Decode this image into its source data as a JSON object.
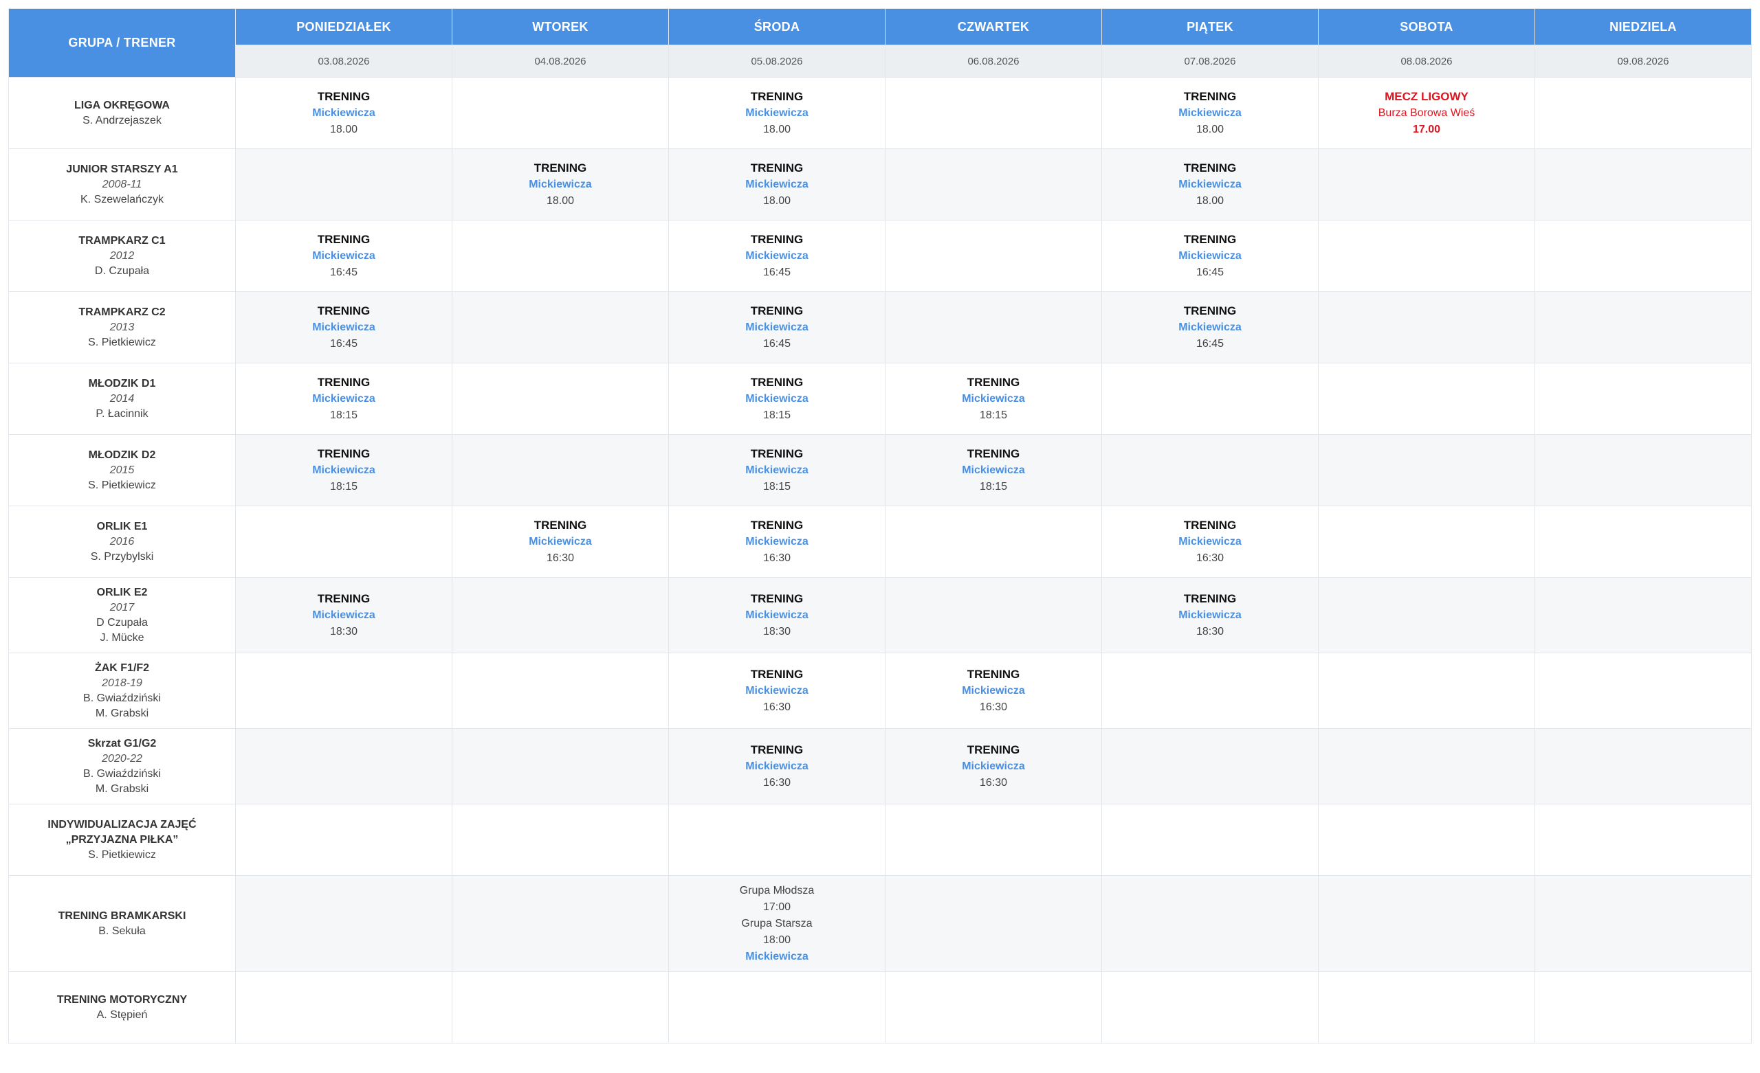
{
  "header": {
    "group_label": "GRUPA / TRENER",
    "days": [
      {
        "name": "PONIEDZIAŁEK",
        "date": "03.08.2026"
      },
      {
        "name": "WTOREK",
        "date": "04.08.2026"
      },
      {
        "name": "ŚRODA",
        "date": "05.08.2026"
      },
      {
        "name": "CZWARTEK",
        "date": "06.08.2026"
      },
      {
        "name": "PIĄTEK",
        "date": "07.08.2026"
      },
      {
        "name": "SOBOTA",
        "date": "08.08.2026"
      },
      {
        "name": "NIEDZIELA",
        "date": "09.08.2026"
      }
    ]
  },
  "colors": {
    "header_blue": "#4a90e2",
    "venue_blue": "#4a90e2",
    "match_red": "#e0141e"
  },
  "rows": [
    {
      "title": "LIGA OKRĘGOWA",
      "years": "",
      "coaches": [
        "S. Andrzejaszek"
      ],
      "cells": [
        {
          "type": "TRENING",
          "venue": "Mickiewicza",
          "time": "18.00"
        },
        null,
        {
          "type": "TRENING",
          "venue": "Mickiewicza",
          "time": "18.00"
        },
        null,
        {
          "type": "TRENING",
          "venue": "Mickiewicza",
          "time": "18.00"
        },
        {
          "type": "MECZ LIGOWY",
          "venue": "Burza Borowa Wieś",
          "time": "17.00",
          "highlight": true
        },
        null
      ]
    },
    {
      "title": "JUNIOR STARSZY A1",
      "years": "2008-11",
      "coaches": [
        "K. Szewelańczyk"
      ],
      "cells": [
        null,
        {
          "type": "TRENING",
          "venue": "Mickiewicza",
          "time": "18.00"
        },
        {
          "type": "TRENING",
          "venue": "Mickiewicza",
          "time": "18.00"
        },
        null,
        {
          "type": "TRENING",
          "venue": "Mickiewicza",
          "time": "18.00"
        },
        null,
        null
      ]
    },
    {
      "title": "TRAMPKARZ C1",
      "years": "2012",
      "coaches": [
        "D. Czupała"
      ],
      "cells": [
        {
          "type": "TRENING",
          "venue": "Mickiewicza",
          "time": "16:45"
        },
        null,
        {
          "type": "TRENING",
          "venue": "Mickiewicza",
          "time": "16:45"
        },
        null,
        {
          "type": "TRENING",
          "venue": "Mickiewicza",
          "time": "16:45"
        },
        null,
        null
      ]
    },
    {
      "title": "TRAMPKARZ C2",
      "years": "2013",
      "coaches": [
        "S. Pietkiewicz"
      ],
      "cells": [
        {
          "type": "TRENING",
          "venue": "Mickiewicza",
          "time": "16:45"
        },
        null,
        {
          "type": "TRENING",
          "venue": "Mickiewicza",
          "time": "16:45"
        },
        null,
        {
          "type": "TRENING",
          "venue": "Mickiewicza",
          "time": "16:45"
        },
        null,
        null
      ]
    },
    {
      "title": "MŁODZIK D1",
      "years": "2014",
      "coaches": [
        "P. Łacinnik"
      ],
      "cells": [
        {
          "type": "TRENING",
          "venue": "Mickiewicza",
          "time": "18:15"
        },
        null,
        {
          "type": "TRENING",
          "venue": "Mickiewicza",
          "time": "18:15"
        },
        {
          "type": "TRENING",
          "venue": "Mickiewicza",
          "time": "18:15"
        },
        null,
        null,
        null
      ]
    },
    {
      "title": "MŁODZIK D2",
      "years": "2015",
      "coaches": [
        "S. Pietkiewicz"
      ],
      "cells": [
        {
          "type": "TRENING",
          "venue": "Mickiewicza",
          "time": "18:15"
        },
        null,
        {
          "type": "TRENING",
          "venue": "Mickiewicza",
          "time": "18:15"
        },
        {
          "type": "TRENING",
          "venue": "Mickiewicza",
          "time": "18:15"
        },
        null,
        null,
        null
      ]
    },
    {
      "title": "ORLIK E1",
      "years": "2016",
      "coaches": [
        "S. Przybylski"
      ],
      "cells": [
        null,
        {
          "type": "TRENING",
          "venue": "Mickiewicza",
          "time": "16:30"
        },
        {
          "type": "TRENING",
          "venue": "Mickiewicza",
          "time": "16:30"
        },
        null,
        {
          "type": "TRENING",
          "venue": "Mickiewicza",
          "time": "16:30"
        },
        null,
        null
      ]
    },
    {
      "title": "ORLIK E2",
      "years": "2017",
      "coaches": [
        "D Czupała",
        "J. Mücke"
      ],
      "cells": [
        {
          "type": "TRENING",
          "venue": "Mickiewicza",
          "time": "18:30"
        },
        null,
        {
          "type": "TRENING",
          "venue": "Mickiewicza",
          "time": "18:30"
        },
        null,
        {
          "type": "TRENING",
          "venue": "Mickiewicza",
          "time": "18:30"
        },
        null,
        null
      ]
    },
    {
      "title": "ŻAK F1/F2",
      "years": "2018-19",
      "coaches": [
        "B. Gwiaździński",
        "M. Grabski"
      ],
      "cells": [
        null,
        null,
        {
          "type": "TRENING",
          "venue": "Mickiewicza",
          "time": "16:30"
        },
        {
          "type": "TRENING",
          "venue": "Mickiewicza",
          "time": "16:30"
        },
        null,
        null,
        null
      ]
    },
    {
      "title": "Skrzat G1/G2",
      "years": "2020-22",
      "coaches": [
        "B. Gwiaździński",
        "M. Grabski"
      ],
      "cells": [
        null,
        null,
        {
          "type": "TRENING",
          "venue": "Mickiewicza",
          "time": "16:30"
        },
        {
          "type": "TRENING",
          "venue": "Mickiewicza",
          "time": "16:30"
        },
        null,
        null,
        null
      ]
    },
    {
      "title": "INDYWIDUALIZACJA ZAJĘĆ\n„PRZYJAZNA PIŁKA”",
      "years": "",
      "coaches": [
        "S. Pietkiewicz"
      ],
      "cells": [
        null,
        null,
        null,
        null,
        null,
        null,
        null
      ]
    },
    {
      "title": "TRENING BRAMKARSKI",
      "years": "",
      "coaches": [
        "B. Sekuła"
      ],
      "cells": [
        null,
        null,
        {
          "lines": [
            "Grupa Młodsza",
            "17:00",
            "Grupa Starsza",
            "18:00"
          ],
          "venue": "Mickiewicza"
        },
        null,
        null,
        null,
        null
      ]
    },
    {
      "title": "TRENING MOTORYCZNY",
      "years": "",
      "coaches": [
        "A. Stępień"
      ],
      "cells": [
        null,
        null,
        null,
        null,
        null,
        null,
        null
      ]
    }
  ]
}
